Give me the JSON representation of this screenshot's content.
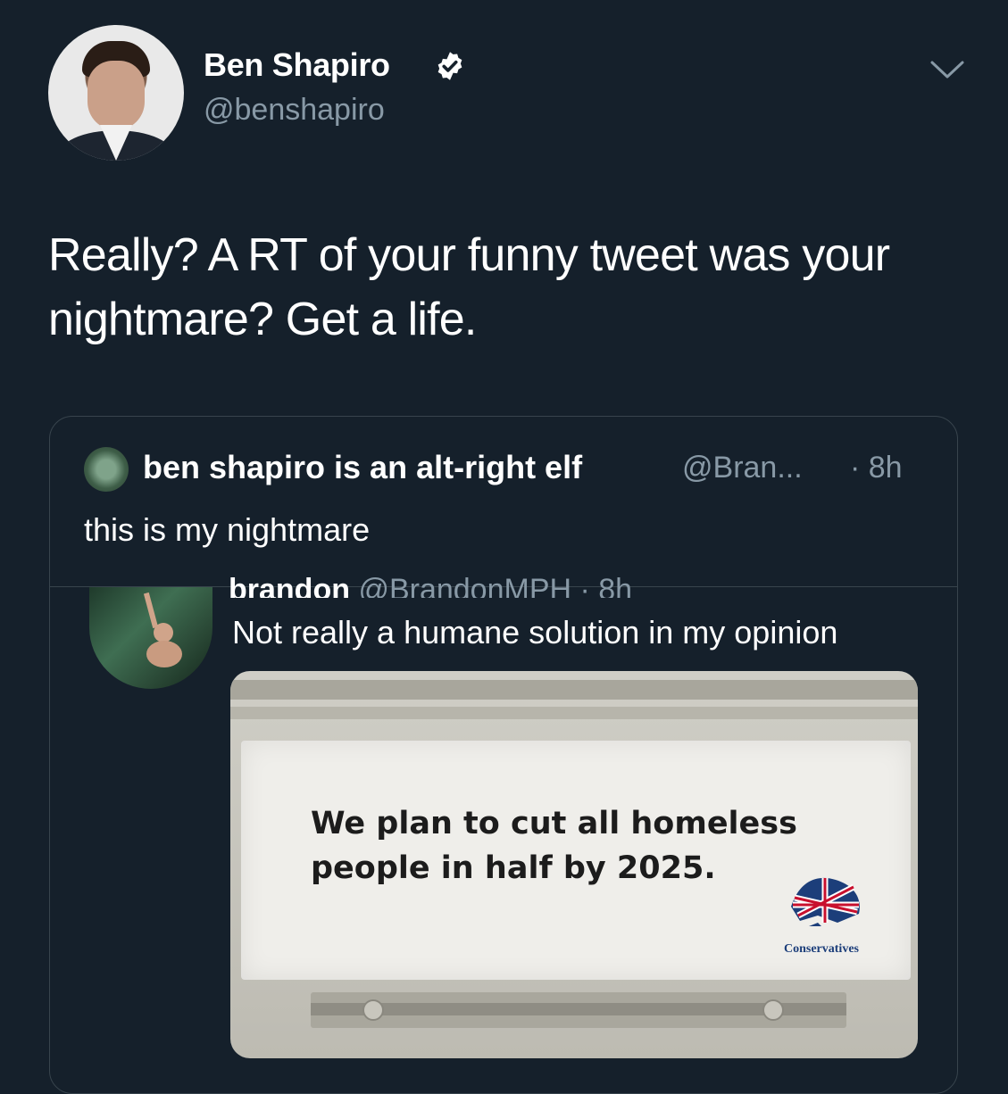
{
  "author": {
    "name": "Ben Shapiro",
    "handle": "@benshapiro",
    "verified": true
  },
  "tweet": {
    "text": "Really? A RT of your funny tweet was your nightmare? Get a life."
  },
  "quoted_tweet": {
    "name": "ben shapiro is an alt-right elf",
    "handle": "@Bran...",
    "time": "· 8h",
    "text": "this is my nightmare"
  },
  "inner_tweet": {
    "cut_header_name": "brandon",
    "cut_header_rest": "@BrandonMPH · 8h",
    "text": "Not really a humane solution in my opinion",
    "image": {
      "sign_text": "We plan to cut all homeless people in half by 2025.",
      "logo_label": "Conservatives"
    }
  },
  "colors": {
    "background": "#15202b",
    "secondary_text": "#8899a6",
    "border": "#38444d",
    "verified_badge": "#ffffff"
  },
  "icons": {
    "verified": "verified-badge-icon",
    "menu": "chevron-down-icon"
  }
}
